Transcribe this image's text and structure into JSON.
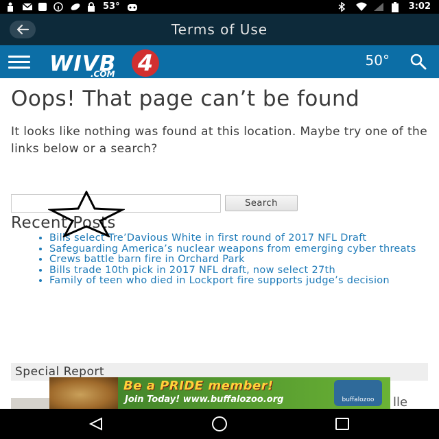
{
  "status_bar": {
    "temperature": "53°",
    "time": "3:02"
  },
  "app_bar": {
    "title": "Terms of Use"
  },
  "site_header": {
    "logo_text": "WIVB",
    "logo_domain": ".COM",
    "logo_channel": "4",
    "temperature": "50°"
  },
  "page": {
    "heading": "Oops! That page can’t be found",
    "message": "It looks like nothing was found at this location. Maybe try one of the links below or a search?",
    "search_input_value": "",
    "search_button_label": "Search",
    "recent_posts_heading": "Recent Posts",
    "recent_posts": [
      "Bills select Tre’Davious White in first round of 2017 NFL Draft",
      "Safeguarding America’s nuclear weapons from emerging cyber threats",
      "Crews battle barn fire in Orchard Park",
      "Bills trade 10th pick in 2017 NFL draft, now select 27th",
      "Family of teen who died in Lockport fire supports judge’s decision"
    ],
    "special_report_heading": "Special Report",
    "partial_text": "lle"
  },
  "ad": {
    "headline": "Be a PRIDE member!",
    "subline": "Join Today! www.buffalozoo.org",
    "brand": "buffalozoo"
  },
  "colors": {
    "app_bar_bg": "#0d2a3a",
    "site_header_bg": "#0c6ea6",
    "link": "#1d7ab8",
    "logo_badge": "#d23030"
  }
}
